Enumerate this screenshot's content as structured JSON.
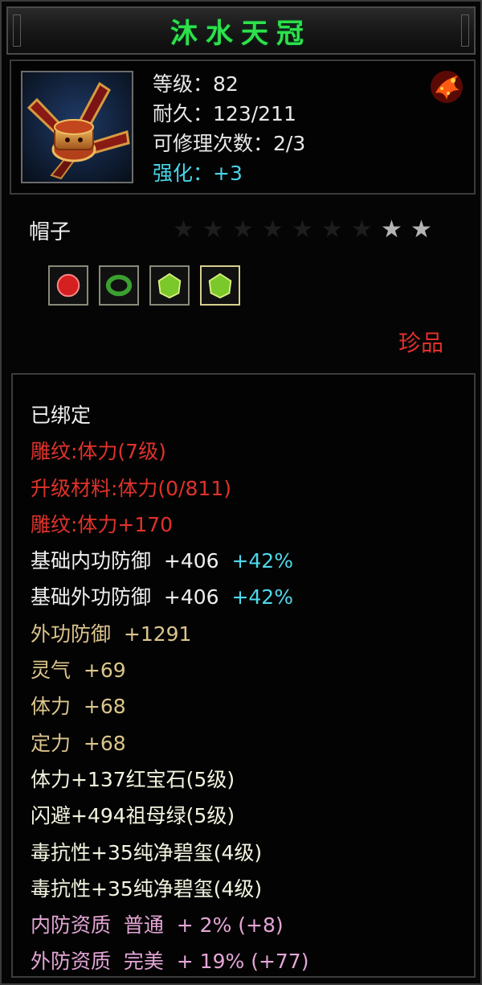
{
  "item": {
    "name": "沐水天冠",
    "icon": "crown-hat-icon",
    "badge_icon": "phoenix-emblem-icon",
    "stats": [
      {
        "label": "等级：",
        "value": "82",
        "color": "#e8e8e8"
      },
      {
        "label": "耐久：",
        "value": "123/211",
        "color": "#e8e8e8"
      },
      {
        "label": "可修理次数：",
        "value": "2/3",
        "color": "#e8e8e8"
      },
      {
        "label": "强化：",
        "value": "+3",
        "color": "#49d4e8"
      }
    ],
    "type": "帽子",
    "stars": {
      "total": 9,
      "filled": 2
    },
    "gems": [
      {
        "icon": "red-ruby-gem-icon",
        "color": "#d42020"
      },
      {
        "icon": "green-emerald-ring-gem-icon",
        "color": "#3aa030"
      },
      {
        "icon": "green-jade-gem-icon",
        "color": "#7ac82a"
      },
      {
        "icon": "green-jade-gem-icon",
        "color": "#7ac82a"
      }
    ],
    "grade": "珍品"
  },
  "attributes": [
    {
      "text": "已绑定",
      "color": "#f2f2f2"
    },
    {
      "text": "雕纹:体力(7级)",
      "color": "#e0322a"
    },
    {
      "text": "升级材料:体力(0/811)",
      "color": "#e0322a"
    },
    {
      "text": "雕纹:体力+170",
      "color": "#e0322a"
    },
    {
      "text": "基础内功防御  +406  ",
      "extra": "+42%",
      "color": "#f0f0f0",
      "extra_color": "#4fd8ea"
    },
    {
      "text": "基础外功防御  +406  ",
      "extra": "+42%",
      "color": "#f0f0f0",
      "extra_color": "#4fd8ea"
    },
    {
      "text": "外功防御  +1291",
      "color": "#dcc58c"
    },
    {
      "text": "灵气  +69",
      "color": "#dcc58c"
    },
    {
      "text": "体力  +68",
      "color": "#dcc58c"
    },
    {
      "text": "定力  +68",
      "color": "#dcc58c"
    },
    {
      "text": "体力+137红宝石(5级)",
      "color": "#f3f3e0"
    },
    {
      "text": "闪避+494祖母绿(5级)",
      "color": "#f3f3e0"
    },
    {
      "text": "毒抗性+35纯净碧玺(4级)",
      "color": "#f3f3e0"
    },
    {
      "text": "毒抗性+35纯净碧玺(4级)",
      "color": "#f3f3e0"
    },
    {
      "text": "内防资质  普通  + 2% (+8)",
      "color": "#e4a6d6"
    },
    {
      "text": "外防资质  完美  + 19% (+77)",
      "color": "#e4a6d6"
    }
  ]
}
